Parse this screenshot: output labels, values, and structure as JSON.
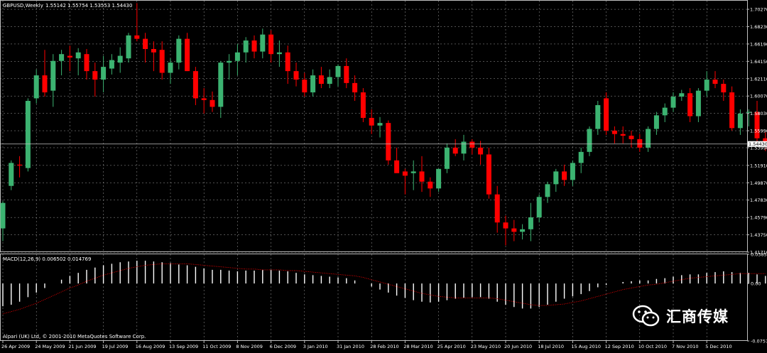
{
  "chart_data": [
    {
      "type": "candlestick",
      "title": "GBPUSD,Weekly",
      "ohlc_header": "1.55142 1.55754 1.53553 1.54430",
      "current_price_label": "1.54430",
      "current_price": 1.5443,
      "up_color": "#3cb371",
      "down_color": "#ff0000",
      "background": "#000000",
      "grid": true,
      "grid_color": "#a0a0a0",
      "ylim": [
        1.4171,
        1.7128
      ],
      "y_ticks": [
        {
          "value": 1.7027,
          "label": "1.70270"
        },
        {
          "value": 1.6823,
          "label": "1.68230"
        },
        {
          "value": 1.6619,
          "label": "1.66190"
        },
        {
          "value": 1.6415,
          "label": "1.64150"
        },
        {
          "value": 1.6211,
          "label": "1.62110"
        },
        {
          "value": 1.6007,
          "label": "1.60070"
        },
        {
          "value": 1.5803,
          "label": "1.58030"
        },
        {
          "value": 1.5599,
          "label": "1.55990"
        },
        {
          "value": 1.5399,
          "label": "1.53990"
        },
        {
          "value": 1.5191,
          "label": "1.51910"
        },
        {
          "value": 1.4987,
          "label": "1.49870"
        },
        {
          "value": 1.4783,
          "label": "1.47830"
        },
        {
          "value": 1.4579,
          "label": "1.45790"
        },
        {
          "value": 1.4375,
          "label": "1.43750"
        },
        {
          "value": 1.4171,
          "label": "1.41710"
        }
      ],
      "x_labels": [
        {
          "week": 0,
          "label": "26 Apr 2009"
        },
        {
          "week": 4,
          "label": "24 May 2009"
        },
        {
          "week": 8,
          "label": "21 Jun 2009"
        },
        {
          "week": 12,
          "label": "19 Jul 2009"
        },
        {
          "week": 16,
          "label": "16 Aug 2009"
        },
        {
          "week": 20,
          "label": "13 Sep 2009"
        },
        {
          "week": 24,
          "label": "11 Oct 2009"
        },
        {
          "week": 28,
          "label": "8 Nov 2009"
        },
        {
          "week": 32,
          "label": "6 Dec 2009"
        },
        {
          "week": 36,
          "label": "3 Jan 2010"
        },
        {
          "week": 40,
          "label": "31 Jan 2010"
        },
        {
          "week": 44,
          "label": "28 Feb 2010"
        },
        {
          "week": 48,
          "label": "28 Mar 2010"
        },
        {
          "week": 52,
          "label": "25 Apr 2010"
        },
        {
          "week": 56,
          "label": "23 May 2010"
        },
        {
          "week": 60,
          "label": "20 Jun 2010"
        },
        {
          "week": 64,
          "label": "18 Jul 2010"
        },
        {
          "week": 68,
          "label": "15 Aug 2010"
        },
        {
          "week": 72,
          "label": "12 Sep 2010"
        },
        {
          "week": 76,
          "label": "10 Oct 2010"
        },
        {
          "week": 80,
          "label": "7 Nov 2010"
        },
        {
          "week": 84,
          "label": "5 Dec 2010"
        }
      ],
      "candles": [
        {
          "o": 1.445,
          "h": 1.477,
          "l": 1.43,
          "c": 1.475
        },
        {
          "o": 1.495,
          "h": 1.525,
          "l": 1.49,
          "c": 1.522
        },
        {
          "o": 1.52,
          "h": 1.53,
          "l": 1.505,
          "c": 1.519
        },
        {
          "o": 1.516,
          "h": 1.598,
          "l": 1.512,
          "c": 1.595
        },
        {
          "o": 1.598,
          "h": 1.632,
          "l": 1.592,
          "c": 1.625
        },
        {
          "o": 1.625,
          "h": 1.655,
          "l": 1.6,
          "c": 1.605
        },
        {
          "o": 1.607,
          "h": 1.65,
          "l": 1.588,
          "c": 1.642
        },
        {
          "o": 1.642,
          "h": 1.655,
          "l": 1.625,
          "c": 1.65
        },
        {
          "o": 1.648,
          "h": 1.66,
          "l": 1.63,
          "c": 1.646
        },
        {
          "o": 1.645,
          "h": 1.657,
          "l": 1.625,
          "c": 1.652
        },
        {
          "o": 1.65,
          "h": 1.656,
          "l": 1.62,
          "c": 1.63
        },
        {
          "o": 1.63,
          "h": 1.64,
          "l": 1.6,
          "c": 1.62
        },
        {
          "o": 1.62,
          "h": 1.648,
          "l": 1.605,
          "c": 1.635
        },
        {
          "o": 1.633,
          "h": 1.65,
          "l": 1.626,
          "c": 1.643
        },
        {
          "o": 1.64,
          "h": 1.658,
          "l": 1.628,
          "c": 1.648
        },
        {
          "o": 1.645,
          "h": 1.675,
          "l": 1.64,
          "c": 1.672
        },
        {
          "o": 1.672,
          "h": 1.71,
          "l": 1.665,
          "c": 1.668
        },
        {
          "o": 1.668,
          "h": 1.675,
          "l": 1.64,
          "c": 1.656
        },
        {
          "o": 1.656,
          "h": 1.665,
          "l": 1.63,
          "c": 1.652
        },
        {
          "o": 1.655,
          "h": 1.665,
          "l": 1.62,
          "c": 1.628
        },
        {
          "o": 1.628,
          "h": 1.645,
          "l": 1.615,
          "c": 1.64
        },
        {
          "o": 1.64,
          "h": 1.672,
          "l": 1.632,
          "c": 1.668
        },
        {
          "o": 1.668,
          "h": 1.675,
          "l": 1.63,
          "c": 1.63
        },
        {
          "o": 1.63,
          "h": 1.635,
          "l": 1.59,
          "c": 1.598
        },
        {
          "o": 1.598,
          "h": 1.61,
          "l": 1.58,
          "c": 1.596
        },
        {
          "o": 1.596,
          "h": 1.606,
          "l": 1.582,
          "c": 1.588
        },
        {
          "o": 1.588,
          "h": 1.642,
          "l": 1.575,
          "c": 1.64
        },
        {
          "o": 1.64,
          "h": 1.65,
          "l": 1.62,
          "c": 1.642
        },
        {
          "o": 1.642,
          "h": 1.662,
          "l": 1.625,
          "c": 1.652
        },
        {
          "o": 1.652,
          "h": 1.67,
          "l": 1.64,
          "c": 1.666
        },
        {
          "o": 1.666,
          "h": 1.672,
          "l": 1.645,
          "c": 1.653
        },
        {
          "o": 1.653,
          "h": 1.68,
          "l": 1.645,
          "c": 1.673
        },
        {
          "o": 1.673,
          "h": 1.678,
          "l": 1.64,
          "c": 1.65
        },
        {
          "o": 1.65,
          "h": 1.666,
          "l": 1.635,
          "c": 1.652
        },
        {
          "o": 1.652,
          "h": 1.66,
          "l": 1.615,
          "c": 1.63
        },
        {
          "o": 1.63,
          "h": 1.64,
          "l": 1.612,
          "c": 1.62
        },
        {
          "o": 1.62,
          "h": 1.628,
          "l": 1.6,
          "c": 1.605
        },
        {
          "o": 1.605,
          "h": 1.632,
          "l": 1.6,
          "c": 1.625
        },
        {
          "o": 1.625,
          "h": 1.635,
          "l": 1.61,
          "c": 1.615
        },
        {
          "o": 1.615,
          "h": 1.632,
          "l": 1.61,
          "c": 1.623
        },
        {
          "o": 1.623,
          "h": 1.638,
          "l": 1.612,
          "c": 1.636
        },
        {
          "o": 1.636,
          "h": 1.645,
          "l": 1.61,
          "c": 1.616
        },
        {
          "o": 1.616,
          "h": 1.625,
          "l": 1.595,
          "c": 1.605
        },
        {
          "o": 1.605,
          "h": 1.61,
          "l": 1.57,
          "c": 1.575
        },
        {
          "o": 1.575,
          "h": 1.585,
          "l": 1.556,
          "c": 1.566
        },
        {
          "o": 1.566,
          "h": 1.576,
          "l": 1.552,
          "c": 1.569
        },
        {
          "o": 1.569,
          "h": 1.572,
          "l": 1.52,
          "c": 1.525
        },
        {
          "o": 1.525,
          "h": 1.54,
          "l": 1.515,
          "c": 1.51
        },
        {
          "o": 1.512,
          "h": 1.515,
          "l": 1.485,
          "c": 1.507
        },
        {
          "o": 1.51,
          "h": 1.525,
          "l": 1.49,
          "c": 1.512
        },
        {
          "o": 1.512,
          "h": 1.53,
          "l": 1.488,
          "c": 1.5
        },
        {
          "o": 1.5,
          "h": 1.505,
          "l": 1.482,
          "c": 1.492
        },
        {
          "o": 1.492,
          "h": 1.515,
          "l": 1.488,
          "c": 1.515
        },
        {
          "o": 1.515,
          "h": 1.545,
          "l": 1.51,
          "c": 1.54
        },
        {
          "o": 1.54,
          "h": 1.55,
          "l": 1.53,
          "c": 1.533
        },
        {
          "o": 1.533,
          "h": 1.555,
          "l": 1.525,
          "c": 1.547
        },
        {
          "o": 1.547,
          "h": 1.55,
          "l": 1.532,
          "c": 1.54
        },
        {
          "o": 1.54,
          "h": 1.548,
          "l": 1.52,
          "c": 1.532
        },
        {
          "o": 1.532,
          "h": 1.54,
          "l": 1.48,
          "c": 1.485
        },
        {
          "o": 1.485,
          "h": 1.495,
          "l": 1.44,
          "c": 1.452
        },
        {
          "o": 1.452,
          "h": 1.46,
          "l": 1.425,
          "c": 1.445
        },
        {
          "o": 1.445,
          "h": 1.455,
          "l": 1.43,
          "c": 1.441
        },
        {
          "o": 1.441,
          "h": 1.45,
          "l": 1.432,
          "c": 1.444
        },
        {
          "o": 1.444,
          "h": 1.475,
          "l": 1.43,
          "c": 1.458
        },
        {
          "o": 1.458,
          "h": 1.485,
          "l": 1.452,
          "c": 1.482
        },
        {
          "o": 1.482,
          "h": 1.5,
          "l": 1.475,
          "c": 1.497
        },
        {
          "o": 1.497,
          "h": 1.515,
          "l": 1.488,
          "c": 1.512
        },
        {
          "o": 1.512,
          "h": 1.52,
          "l": 1.495,
          "c": 1.502
        },
        {
          "o": 1.502,
          "h": 1.525,
          "l": 1.495,
          "c": 1.522
        },
        {
          "o": 1.522,
          "h": 1.54,
          "l": 1.51,
          "c": 1.535
        },
        {
          "o": 1.535,
          "h": 1.565,
          "l": 1.53,
          "c": 1.562
        },
        {
          "o": 1.562,
          "h": 1.595,
          "l": 1.555,
          "c": 1.59
        },
        {
          "o": 1.598,
          "h": 1.605,
          "l": 1.555,
          "c": 1.56
        },
        {
          "o": 1.56,
          "h": 1.565,
          "l": 1.545,
          "c": 1.556
        },
        {
          "o": 1.556,
          "h": 1.565,
          "l": 1.545,
          "c": 1.554
        },
        {
          "o": 1.554,
          "h": 1.56,
          "l": 1.54,
          "c": 1.55
        },
        {
          "o": 1.55,
          "h": 1.556,
          "l": 1.535,
          "c": 1.54
        },
        {
          "o": 1.54,
          "h": 1.565,
          "l": 1.535,
          "c": 1.562
        },
        {
          "o": 1.562,
          "h": 1.582,
          "l": 1.555,
          "c": 1.578
        },
        {
          "o": 1.578,
          "h": 1.592,
          "l": 1.57,
          "c": 1.587
        },
        {
          "o": 1.587,
          "h": 1.605,
          "l": 1.582,
          "c": 1.6
        },
        {
          "o": 1.6,
          "h": 1.608,
          "l": 1.595,
          "c": 1.604
        },
        {
          "o": 1.604,
          "h": 1.61,
          "l": 1.57,
          "c": 1.577
        },
        {
          "o": 1.577,
          "h": 1.61,
          "l": 1.57,
          "c": 1.607
        },
        {
          "o": 1.607,
          "h": 1.63,
          "l": 1.6,
          "c": 1.62
        },
        {
          "o": 1.62,
          "h": 1.63,
          "l": 1.61,
          "c": 1.615
        },
        {
          "o": 1.615,
          "h": 1.62,
          "l": 1.595,
          "c": 1.605
        },
        {
          "o": 1.605,
          "h": 1.612,
          "l": 1.56,
          "c": 1.563
        },
        {
          "o": 1.563,
          "h": 1.585,
          "l": 1.555,
          "c": 1.58
        },
        {
          "o": 1.581,
          "h": 1.585,
          "l": 1.565,
          "c": 1.582
        },
        {
          "o": 1.582,
          "h": 1.595,
          "l": 1.545,
          "c": 1.551
        },
        {
          "o": 1.551,
          "h": 1.558,
          "l": 1.536,
          "c": 1.544
        }
      ]
    },
    {
      "type": "histogram",
      "title": "MACD(12,26,9) 0.006502 0.014769",
      "params": "12,26,9",
      "macd_value": 0.006502,
      "signal_value": 0.014769,
      "signal_color": "#ff0000",
      "bar_color": "#ffffff",
      "ylim": [
        -0.0757,
        0.0385
      ],
      "y_ticks": [
        {
          "value": 0.03851,
          "label": "0.03851"
        },
        {
          "value": 0.0,
          "label": "0.00"
        },
        {
          "value": -0.07571,
          "label": "-0.07571"
        }
      ],
      "macd": [
        -0.03,
        -0.028,
        -0.024,
        -0.018,
        -0.012,
        -0.006,
        0.0,
        0.005,
        0.01,
        0.014,
        0.018,
        0.021,
        0.024,
        0.026,
        0.028,
        0.029,
        0.03,
        0.03,
        0.029,
        0.028,
        0.027,
        0.025,
        0.024,
        0.022,
        0.02,
        0.018,
        0.018,
        0.017,
        0.016,
        0.017,
        0.017,
        0.018,
        0.018,
        0.017,
        0.016,
        0.014,
        0.012,
        0.011,
        0.01,
        0.009,
        0.008,
        0.007,
        0.004,
        0.0,
        -0.004,
        -0.008,
        -0.012,
        -0.016,
        -0.019,
        -0.022,
        -0.024,
        -0.025,
        -0.024,
        -0.022,
        -0.02,
        -0.019,
        -0.018,
        -0.018,
        -0.02,
        -0.024,
        -0.028,
        -0.031,
        -0.033,
        -0.033,
        -0.031,
        -0.028,
        -0.024,
        -0.02,
        -0.017,
        -0.014,
        -0.01,
        -0.005,
        -0.002,
        0.0,
        0.002,
        0.003,
        0.004,
        0.004,
        0.006,
        0.007,
        0.009,
        0.011,
        0.012,
        0.012,
        0.014,
        0.015,
        0.016,
        0.015,
        0.014,
        0.014,
        0.012,
        0.01
      ],
      "signal": [
        -0.04,
        -0.037,
        -0.034,
        -0.03,
        -0.026,
        -0.021,
        -0.016,
        -0.011,
        -0.006,
        -0.002,
        0.003,
        0.007,
        0.011,
        0.014,
        0.017,
        0.02,
        0.022,
        0.024,
        0.025,
        0.026,
        0.026,
        0.026,
        0.026,
        0.025,
        0.024,
        0.023,
        0.022,
        0.021,
        0.02,
        0.019,
        0.019,
        0.018,
        0.018,
        0.018,
        0.017,
        0.017,
        0.016,
        0.015,
        0.014,
        0.013,
        0.012,
        0.011,
        0.01,
        0.008,
        0.005,
        0.002,
        -0.001,
        -0.004,
        -0.007,
        -0.01,
        -0.013,
        -0.015,
        -0.017,
        -0.018,
        -0.019,
        -0.019,
        -0.019,
        -0.019,
        -0.019,
        -0.02,
        -0.022,
        -0.024,
        -0.026,
        -0.028,
        -0.029,
        -0.029,
        -0.028,
        -0.027,
        -0.025,
        -0.023,
        -0.02,
        -0.017,
        -0.014,
        -0.011,
        -0.008,
        -0.006,
        -0.004,
        -0.002,
        -0.001,
        0.001,
        0.003,
        0.005,
        0.007,
        0.008,
        0.009,
        0.01,
        0.011,
        0.012,
        0.013,
        0.013,
        0.013,
        0.013
      ]
    }
  ],
  "footer": {
    "copyright": "Alpari (UK) Ltd, © 2001-2010 MetaQuotes Software Corp."
  },
  "watermark": {
    "text": "汇商传媒",
    "icon": "wechat-icon"
  }
}
